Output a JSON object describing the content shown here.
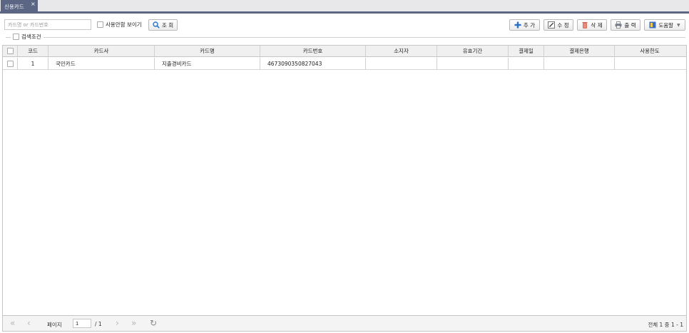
{
  "tab": {
    "label": "신용카드",
    "close": "×"
  },
  "search": {
    "placeholder": "카드명 or 카드번호",
    "show_unused_label": "사용안함 보이기",
    "search_button": "조 회"
  },
  "toolbar": {
    "add": "추 가",
    "edit": "수 정",
    "delete": "삭 제",
    "print": "출 력",
    "help": "도움말"
  },
  "conditions": {
    "label": "검색조건"
  },
  "grid": {
    "columns": [
      "코드",
      "카드사",
      "카드명",
      "카드번호",
      "소지자",
      "유효기간",
      "결제일",
      "결제은행",
      "사용한도"
    ],
    "rows": [
      {
        "code": "1",
        "company": "국민카드",
        "name": "지출경비카드",
        "number": "4673090350827043",
        "holder": "",
        "expiry": "",
        "pay_day": "",
        "pay_bank": "",
        "limit": ""
      }
    ]
  },
  "pager": {
    "page_label": "페이지",
    "page_value": "1",
    "total_pages": "/ 1",
    "summary": "전체 1 중 1 - 1"
  },
  "colors": {
    "tab_bg": "#5b6684",
    "add_icon": "#2a72c8",
    "delete_icon": "#d8604f"
  }
}
